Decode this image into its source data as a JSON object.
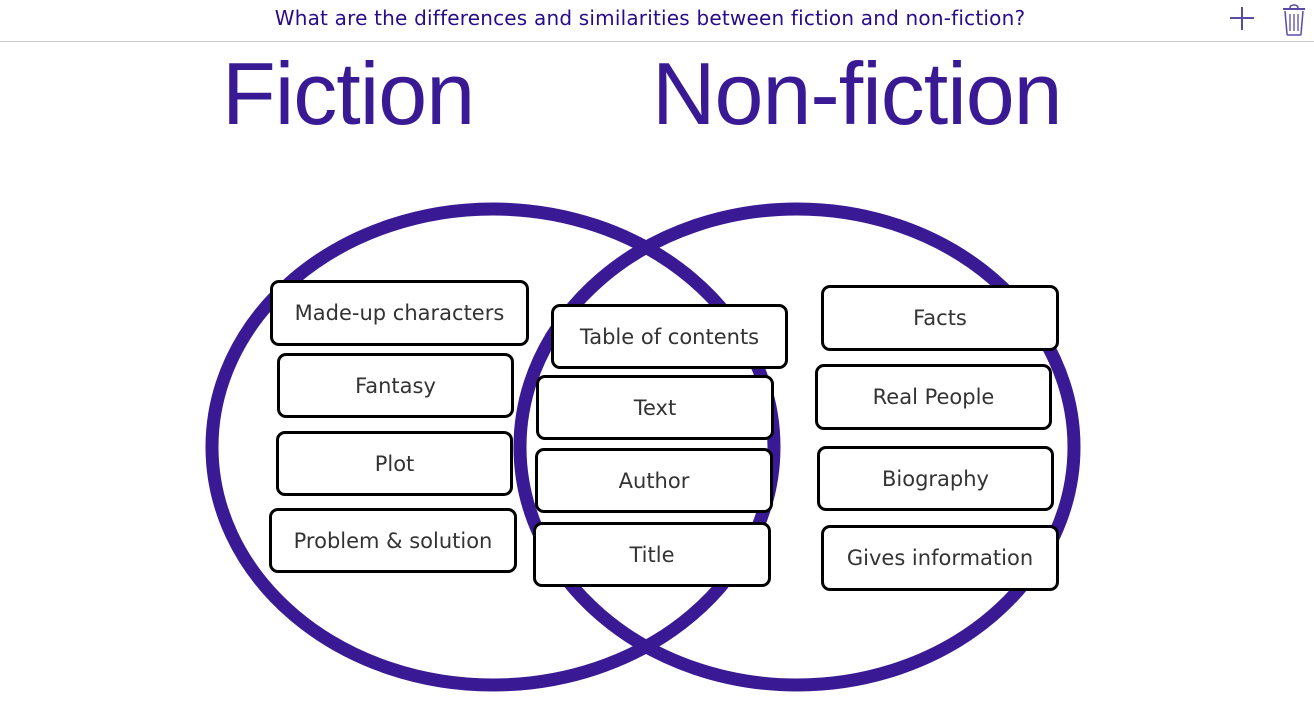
{
  "header": {
    "question": "What are the differences and similarities between fiction and non-fiction?",
    "add_icon": "plus-icon",
    "delete_icon": "trash-icon"
  },
  "diagram": {
    "left_heading": "Fiction",
    "right_heading": "Non-fiction",
    "circle_color": "#3a1a94",
    "fiction_cards": [
      "Made-up characters",
      "Fantasy",
      "Plot",
      "Problem & solution"
    ],
    "both_cards": [
      "Table of contents",
      "Text",
      "Author",
      "Title"
    ],
    "nonfiction_cards": [
      "Facts",
      "Real People",
      "Biography",
      "Gives information"
    ]
  }
}
